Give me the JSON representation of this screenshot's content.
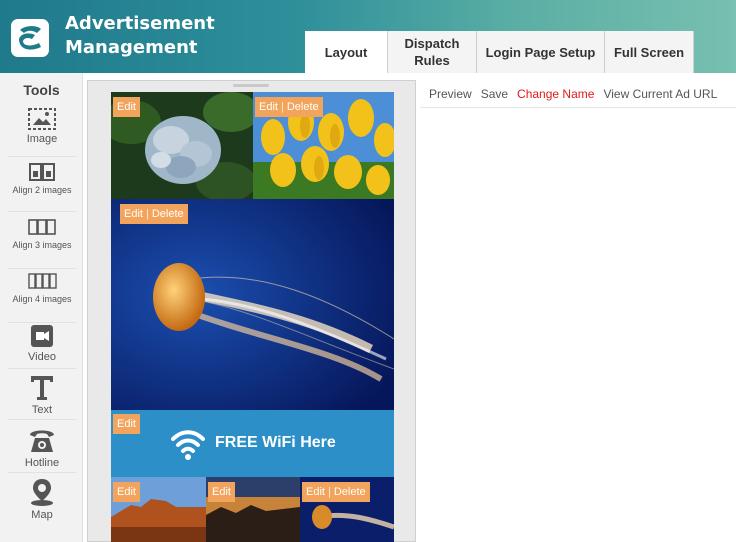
{
  "header": {
    "title_line1": "Advertisement",
    "title_line2": "Management",
    "tabs": [
      {
        "label": "Layout"
      },
      {
        "label_line1": "Dispatch",
        "label_line2": "Rules"
      },
      {
        "label": "Login Page Setup"
      },
      {
        "label": "Full Screen"
      }
    ]
  },
  "tools": {
    "title": "Tools",
    "items": [
      {
        "label": "Image",
        "icon": "image-icon"
      },
      {
        "label": "Align 2 images",
        "icon": "align-2-images-icon"
      },
      {
        "label": "Align 3 images",
        "icon": "align-3-images-icon"
      },
      {
        "label": "Align 4 images",
        "icon": "align-4-images-icon"
      },
      {
        "label": "Video",
        "icon": "video-icon"
      },
      {
        "label": "Text",
        "icon": "text-icon"
      },
      {
        "label": "Hotline",
        "icon": "phone-icon"
      },
      {
        "label": "Map",
        "icon": "map-pin-icon"
      }
    ]
  },
  "actions": {
    "preview": "Preview",
    "save": "Save",
    "change_name": "Change Name",
    "view_url": "View Current Ad URL"
  },
  "canvas": {
    "edit": "Edit",
    "delete": "Delete",
    "wifi_text": "FREE WiFi Here"
  },
  "colors": {
    "header_gradient_start": "#1f7a8c",
    "header_gradient_end": "#78c0b0",
    "badge": "#f2a35c",
    "wifi_banner": "#2c8fc8",
    "danger": "#e01b1b"
  }
}
